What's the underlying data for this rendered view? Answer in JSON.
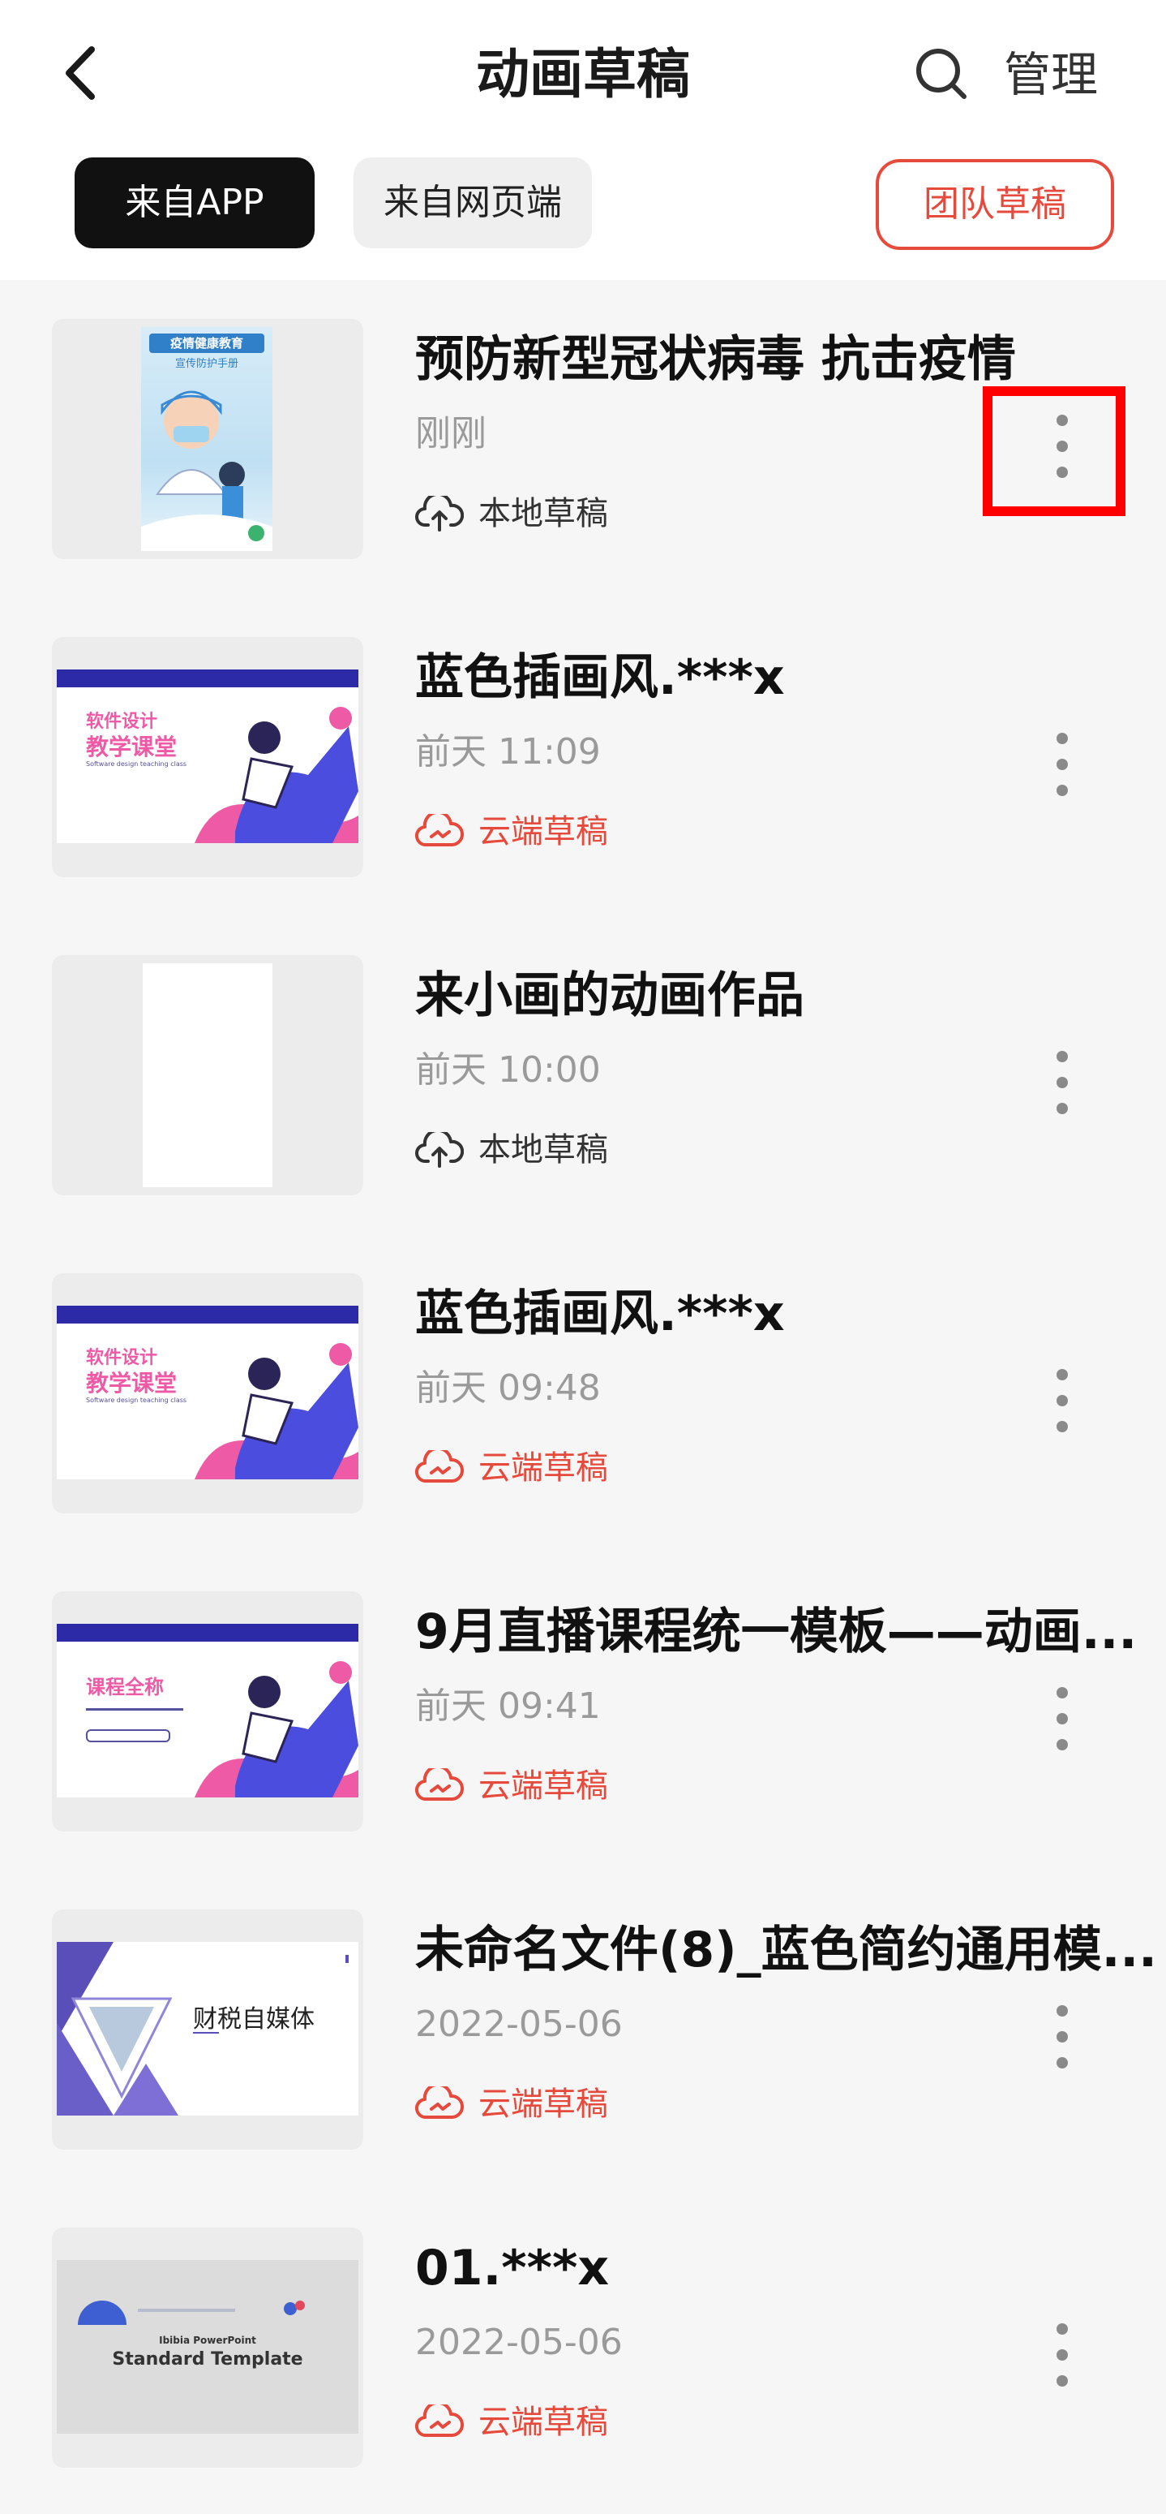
{
  "header": {
    "title": "动画草稿",
    "manage_label": "管理"
  },
  "tabs": {
    "app": "来自APP",
    "web": "来自网页端",
    "team": "团队草稿"
  },
  "drafts": [
    {
      "title": "预防新型冠状病毒  抗击疫情",
      "time": "刚刚",
      "status": "本地草稿",
      "thumb_text": [
        "疫情健康教育",
        "宣传防护手册"
      ]
    },
    {
      "title": "蓝色插画风.***x",
      "time": "前天 11:09",
      "status": "云端草稿",
      "thumb_text": [
        "软件设计",
        "教学课堂",
        "Software design teaching class"
      ]
    },
    {
      "title": "来小画的动画作品",
      "time": "前天 10:00",
      "status": "本地草稿"
    },
    {
      "title": "蓝色插画风.***x",
      "time": "前天 09:48",
      "status": "云端草稿",
      "thumb_text": [
        "软件设计",
        "教学课堂",
        "Software design teaching class"
      ]
    },
    {
      "title": "9月直播课程统一模板——动画...",
      "time": "前天 09:41",
      "status": "云端草稿",
      "thumb_text": [
        "课程全称"
      ]
    },
    {
      "title": "未命名文件(8)_蓝色简约通用模...",
      "time": "2022-05-06",
      "status": "云端草稿",
      "thumb_text": [
        "财税自媒体"
      ]
    },
    {
      "title": "01.***x",
      "time": "2022-05-06",
      "status": "云端草稿",
      "thumb_text": [
        "Ibibia PowerPoint",
        "Standard Template"
      ]
    }
  ],
  "colors": {
    "accent": "#e64a3c",
    "highlight": "#ff0000",
    "tab_active_bg": "#111111"
  },
  "icons": {
    "back": "chevron-left-icon",
    "search": "search-icon",
    "local": "cloud-upload-icon",
    "cloud": "cloud-icon",
    "more": "more-vertical-icon"
  }
}
